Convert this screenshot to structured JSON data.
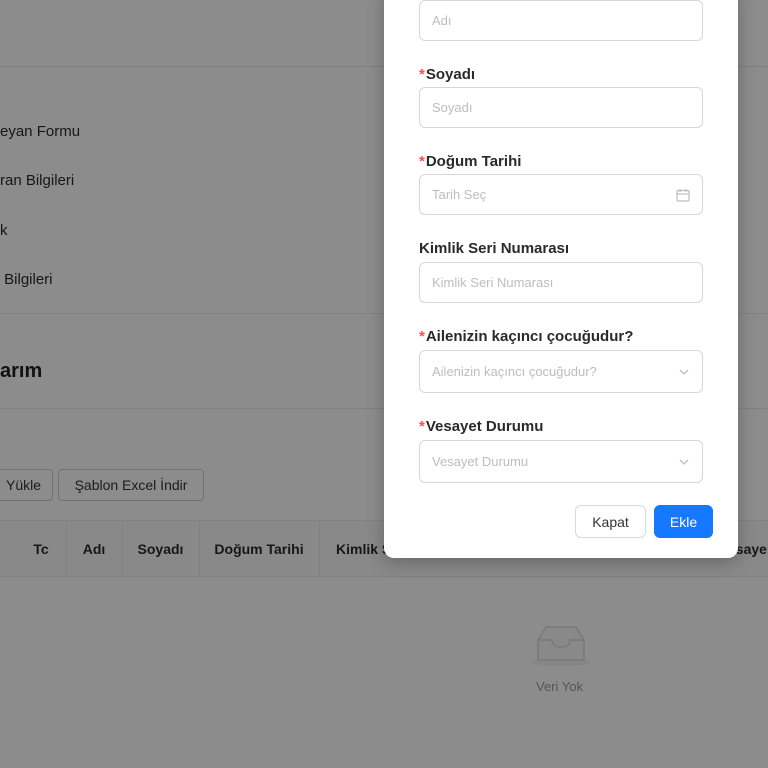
{
  "sidebar": {
    "items": [
      {
        "label": "eyan Formu"
      },
      {
        "label": "ran Bilgileri"
      },
      {
        "label": "k"
      },
      {
        "label": " Bilgileri"
      }
    ]
  },
  "section": {
    "title": "arım"
  },
  "toolbar": {
    "upload_label": "Yükle",
    "template_label": "Şablon Excel İndir"
  },
  "table": {
    "columns": [
      "Tc",
      "Adı",
      "Soyadı",
      "Doğum Tarihi",
      "Kimlik S",
      "esaye"
    ],
    "empty_text": "Veri Yok"
  },
  "modal": {
    "fields": [
      {
        "label": "",
        "required": false,
        "placeholder": "Adı",
        "kind": "text"
      },
      {
        "label": "Soyadı",
        "required": true,
        "placeholder": "Soyadı",
        "kind": "text"
      },
      {
        "label": "Doğum Tarihi",
        "required": true,
        "placeholder": "Tarih Seç",
        "kind": "date"
      },
      {
        "label": "Kimlik Seri Numarası",
        "required": false,
        "placeholder": "Kimlik Seri Numarası",
        "kind": "text"
      },
      {
        "label": "Ailenizin kaçıncı çocuğudur?",
        "required": true,
        "placeholder": "Ailenizin kaçıncı çocuğudur?",
        "kind": "select"
      },
      {
        "label": "Vesayet Durumu",
        "required": true,
        "placeholder": "Vesayet Durumu",
        "kind": "select"
      }
    ],
    "required_mark": "*",
    "cancel_label": "Kapat",
    "submit_label": "Ekle"
  },
  "colors": {
    "primary": "#1677ff",
    "required": "#ff4d4f",
    "overlay": "rgba(0,0,0,0.45)"
  }
}
